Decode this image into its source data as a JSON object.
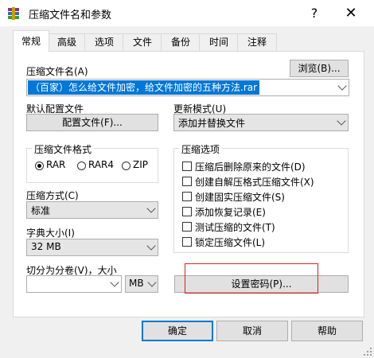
{
  "window": {
    "title": "压缩文件名和参数",
    "help_glyph": "?",
    "close_glyph": "✕"
  },
  "tabs": [
    "常规",
    "高级",
    "选项",
    "文件",
    "备份",
    "时间",
    "注释"
  ],
  "archive_name": {
    "label": "压缩文件名(A)",
    "value": "（百家）怎么给文件加密，给文件加密的五种方法.rar",
    "browse_button": "浏览(B)..."
  },
  "default_profile": {
    "label": "默认配置文件",
    "button": "配置文件(F)..."
  },
  "update_mode": {
    "label": "更新模式(U)",
    "value": "添加并替换文件"
  },
  "archive_format": {
    "label": "压缩文件格式",
    "options": [
      "RAR",
      "RAR4",
      "ZIP"
    ],
    "selected": "RAR"
  },
  "compression_method": {
    "label": "压缩方式(C)",
    "value": "标准"
  },
  "dictionary_size": {
    "label": "字典大小(I)",
    "value": "32 MB"
  },
  "split_volumes": {
    "label": "切分为分卷(V)，大小",
    "value": "",
    "unit": "MB"
  },
  "archive_options": {
    "label": "压缩选项",
    "items": [
      {
        "label": "压缩后删除原来的文件(D)",
        "checked": false
      },
      {
        "label": "创建自解压格式压缩文件(X)",
        "checked": false
      },
      {
        "label": "创建固实压缩文件(S)",
        "checked": false
      },
      {
        "label": "添加恢复记录(E)",
        "checked": false
      },
      {
        "label": "测试压缩的文件(T)",
        "checked": false
      },
      {
        "label": "锁定压缩文件(L)",
        "checked": false
      }
    ]
  },
  "set_password_button": "设置密码(P)...",
  "footer": {
    "ok": "确定",
    "cancel": "取消",
    "help": "帮助"
  },
  "colors": {
    "selection": "#0078d7",
    "highlight_box": "#e02020"
  }
}
